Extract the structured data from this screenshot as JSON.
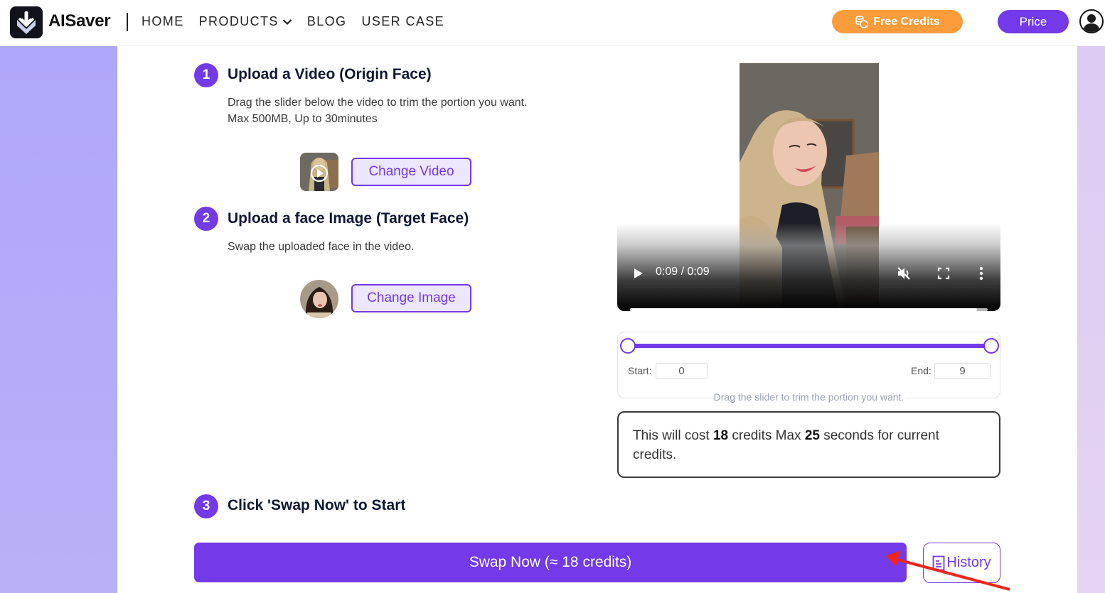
{
  "header": {
    "brand": "AISaver",
    "nav": [
      {
        "label": "HOME",
        "has_dropdown": false
      },
      {
        "label": "PRODUCTS",
        "has_dropdown": true
      },
      {
        "label": "BLOG",
        "has_dropdown": false
      },
      {
        "label": "USER CASE",
        "has_dropdown": false
      }
    ],
    "free_credits_label": "Free Credits",
    "price_label": "Price",
    "icons": {
      "logo": "download-arrow-logo-icon",
      "coins": "coins-icon",
      "avatar": "user-avatar-icon",
      "chevron": "chevron-down-icon"
    }
  },
  "colors": {
    "accent": "#7439e8",
    "orange": "#fd9c3b",
    "bg_left": "#aea6f9",
    "bg_right": "#dccbf3",
    "annotation_arrow": "#f0241b"
  },
  "steps": [
    {
      "number": "1",
      "title": "Upload a Video (Origin Face)",
      "desc_lines": [
        "Drag the slider below the video to trim the portion you want.",
        "Max 500MB, Up to 30minutes"
      ],
      "button_label": "Change Video"
    },
    {
      "number": "2",
      "title": "Upload a face Image (Target Face)",
      "desc_lines": [
        "Swap the uploaded face in the video."
      ],
      "button_label": "Change Image"
    },
    {
      "number": "3",
      "title": "Click 'Swap Now' to Start"
    }
  ],
  "video_player": {
    "time_display": "0:09 / 0:09",
    "progress": 0.97,
    "muted": true,
    "icons": [
      "play-icon",
      "mute-icon",
      "fullscreen-icon",
      "more-options-icon"
    ]
  },
  "trim": {
    "start_label": "Start:",
    "start_value": "0",
    "end_label": "End:",
    "end_value": "9",
    "range_start_fraction": 0.0,
    "range_end_fraction": 1.0,
    "caption": "Drag the slider to trim the portion you want."
  },
  "cost": {
    "prefix": "This will cost ",
    "credits": "18",
    "middle": " credits Max ",
    "seconds": "25",
    "suffix": " seconds for current credits."
  },
  "actions": {
    "swap_label": "Swap Now (≈ 18 credits)",
    "history_label": "History"
  }
}
